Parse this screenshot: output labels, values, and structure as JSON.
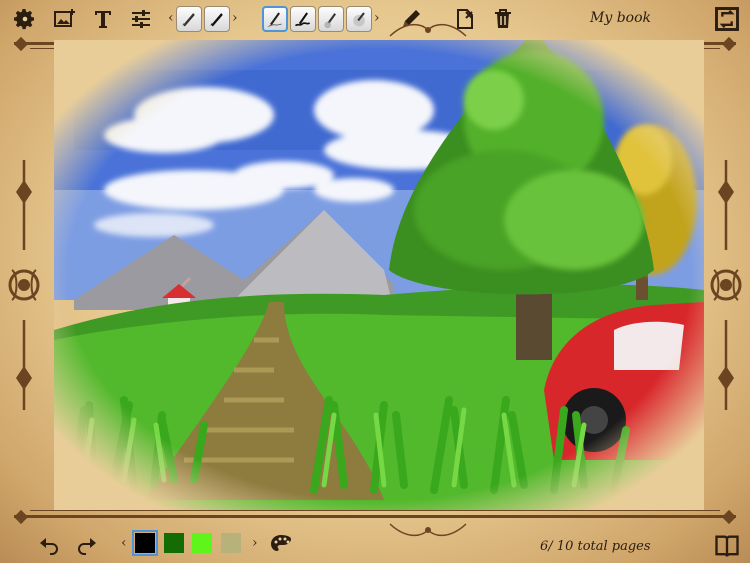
{
  "toolbar": {
    "book_title": "My book",
    "left_tools": [
      "settings-icon",
      "insert-image-icon",
      "text-tool-icon",
      "adjust-sliders-icon"
    ],
    "brush_groups": [
      {
        "brushes": [
          "marker",
          "marker-dark"
        ]
      },
      {
        "brushes": [
          "pencil-selected",
          "ink",
          "airbrush",
          "eraser"
        ]
      }
    ],
    "right_tools": [
      "pen-icon",
      "clear-page-icon",
      "delete-icon"
    ],
    "corner_tool": "swap-pages-icon"
  },
  "bottom": {
    "swatches": [
      "#000000",
      "#136d04",
      "#5ff51a",
      "#b7b279"
    ],
    "selected_swatch": 0,
    "page_current": "6",
    "page_total_text": "/ 10 total pages",
    "tools": [
      "undo-icon",
      "redo-icon",
      "palette-icon",
      "book-view-icon"
    ]
  },
  "colors": {
    "accent": "#4f94d8",
    "ornament": "#6b4421"
  }
}
